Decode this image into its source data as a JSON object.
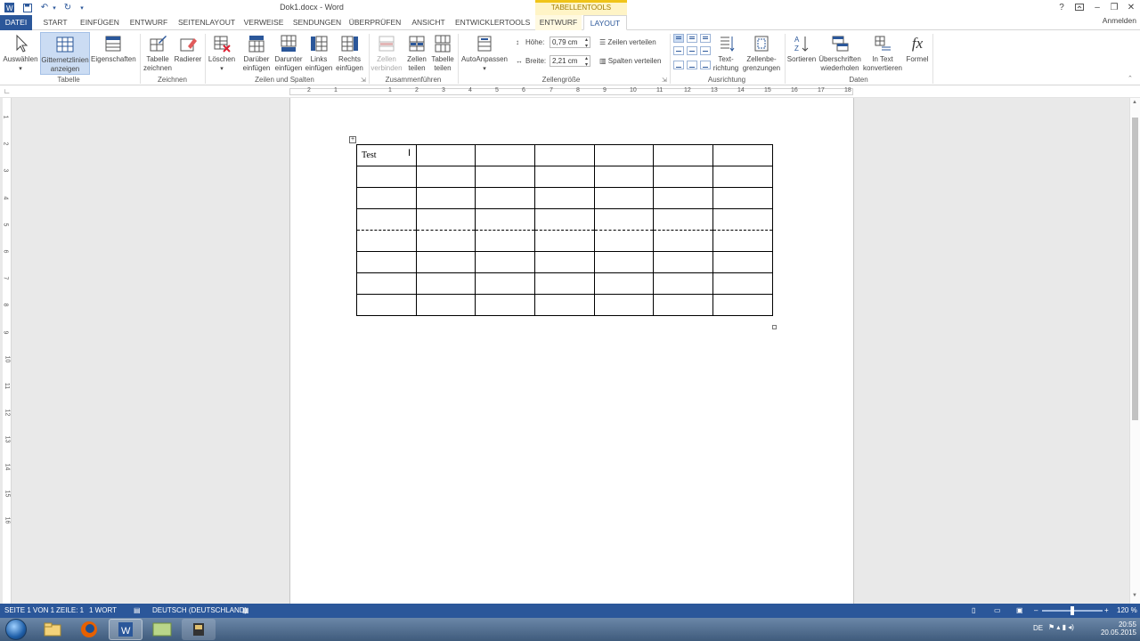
{
  "window": {
    "title": "Dok1.docx - Word",
    "context_group": "TABELLENTOOLS",
    "sign_in": "Anmelden",
    "help": "?"
  },
  "tabs": {
    "file": "DATEI",
    "items": [
      "START",
      "EINFÜGEN",
      "ENTWURF",
      "SEITENLAYOUT",
      "VERWEISE",
      "SENDUNGEN",
      "ÜBERPRÜFEN",
      "ANSICHT",
      "ENTWICKLERTOOLS"
    ],
    "ctx_design": "ENTWURF",
    "ctx_layout": "LAYOUT"
  },
  "ribbon": {
    "table": {
      "label": "Tabelle",
      "select": "Auswählen",
      "gridlines_1": "Gitternetzlinien",
      "gridlines_2": "anzeigen",
      "properties": "Eigenschaften"
    },
    "draw": {
      "label": "Zeichnen",
      "draw_table_1": "Tabelle",
      "draw_table_2": "zeichnen",
      "eraser": "Radierer"
    },
    "rows_cols": {
      "label": "Zeilen und Spalten",
      "delete": "Löschen",
      "above_1": "Darüber",
      "above_2": "einfügen",
      "below_1": "Darunter",
      "below_2": "einfügen",
      "left_1": "Links",
      "left_2": "einfügen",
      "right_1": "Rechts",
      "right_2": "einfügen"
    },
    "merge": {
      "label": "Zusammenführen",
      "merge_1": "Zellen",
      "merge_2": "verbinden",
      "split_cells_1": "Zellen",
      "split_cells_2": "teilen",
      "split_table_1": "Tabelle",
      "split_table_2": "teilen"
    },
    "cell_size": {
      "label": "Zellengröße",
      "autofit": "AutoAnpassen",
      "height_label": "Höhe:",
      "height_value": "0,79 cm",
      "width_label": "Breite:",
      "width_value": "2,21 cm",
      "distribute_rows": "Zeilen verteilen",
      "distribute_cols": "Spalten verteilen"
    },
    "alignment": {
      "label": "Ausrichtung",
      "text_dir_1": "Text-",
      "text_dir_2": "richtung",
      "margins_1": "Zellenbe-",
      "margins_2": "grenzungen"
    },
    "data": {
      "label": "Daten",
      "sort": "Sortieren",
      "repeat_1": "Überschriften",
      "repeat_2": "wiederholen",
      "convert_1": "In Text",
      "convert_2": "konvertieren",
      "formula": "Formel",
      "formula_glyph": "fx"
    }
  },
  "ruler": {
    "h_numbers": [
      "2",
      "1",
      "1",
      "2",
      "3",
      "4",
      "5",
      "6",
      "7",
      "8",
      "9",
      "10",
      "11",
      "12",
      "13",
      "14",
      "15",
      "16",
      "17",
      "18"
    ],
    "v_numbers": [
      "1",
      "2",
      "3",
      "4",
      "5",
      "6",
      "7",
      "8",
      "9",
      "10",
      "11",
      "12",
      "13",
      "14",
      "15",
      "16"
    ]
  },
  "document": {
    "table": {
      "rows": [
        [
          "Test",
          "",
          "",
          "",
          "",
          "",
          ""
        ],
        [
          "",
          "",
          "",
          "",
          "",
          "",
          ""
        ],
        [
          "",
          "",
          "",
          "",
          "",
          "",
          ""
        ],
        [
          "",
          "",
          "",
          "",
          "",
          "",
          ""
        ],
        [
          "",
          "",
          "",
          "",
          "",
          "",
          ""
        ],
        [
          "",
          "",
          "",
          "",
          "",
          "",
          ""
        ],
        [
          "",
          "",
          "",
          "",
          "",
          "",
          ""
        ],
        [
          "",
          "",
          "",
          "",
          "",
          "",
          ""
        ]
      ]
    }
  },
  "status": {
    "page": "SEITE 1 VON 1",
    "line": "ZEILE: 1",
    "words": "1 WORT",
    "language": "DEUTSCH (DEUTSCHLAND)",
    "zoom": "120 %"
  },
  "taskbar": {
    "lang": "DE",
    "time": "20:55",
    "date": "20.05.2015"
  },
  "colors": {
    "accent": "#2b579a",
    "context": "#f0c419"
  }
}
